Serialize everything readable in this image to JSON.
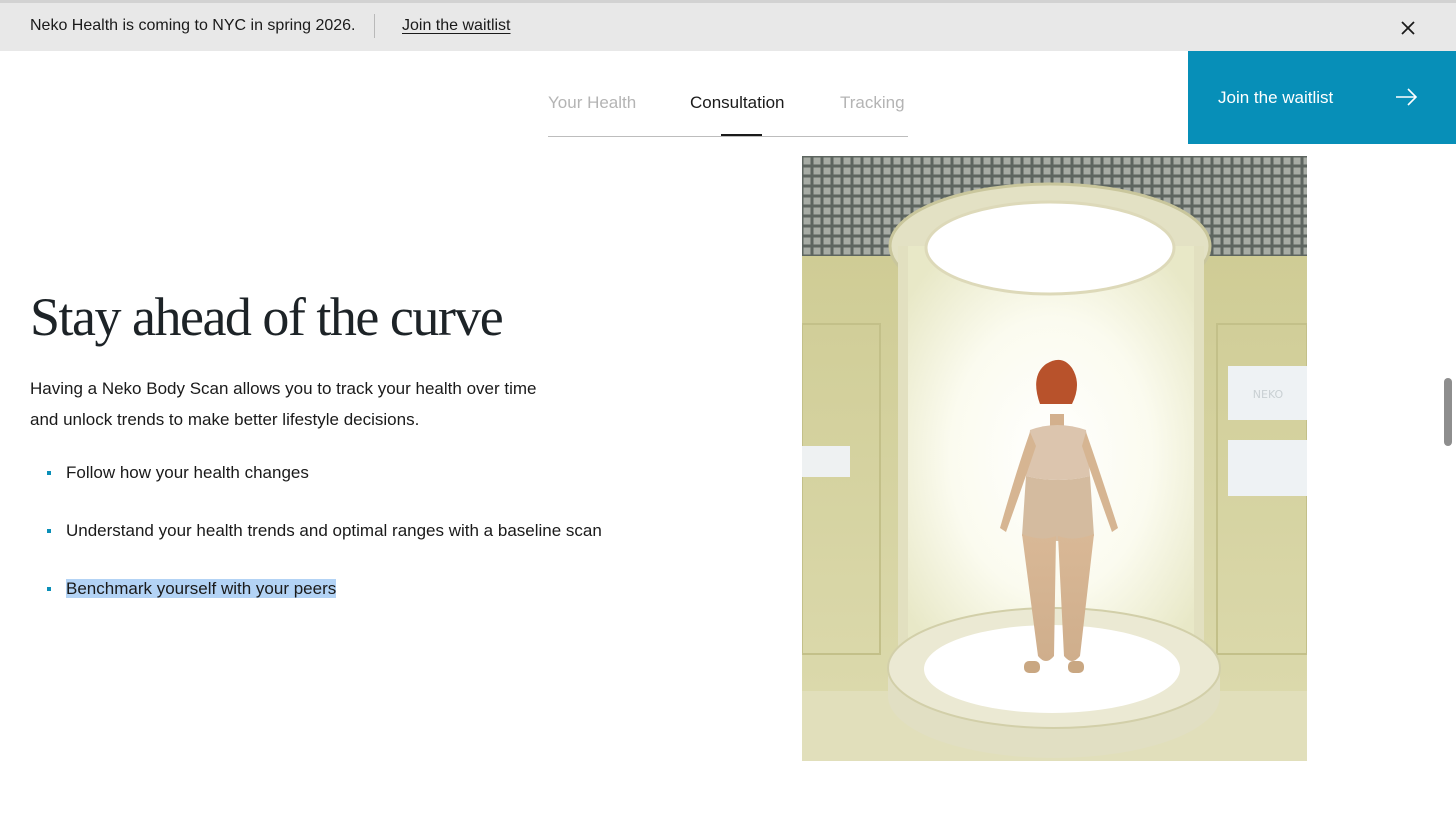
{
  "announcement": {
    "text": "Neko Health is coming to NYC in spring 2026.",
    "link_label": "Join the waitlist",
    "close_icon": "close-icon"
  },
  "tabs": [
    {
      "label": "Your Health",
      "active": false
    },
    {
      "label": "Consultation",
      "active": true
    },
    {
      "label": "Tracking",
      "active": false
    }
  ],
  "cta": {
    "label": "Join the waitlist",
    "icon": "arrow-right-icon",
    "color": "#078fb8"
  },
  "content": {
    "headline": "Stay ahead of the curve",
    "intro": "Having a Neko Body Scan allows you to track your health over time and unlock trends to make better lifestyle decisions.",
    "bullets": [
      "Follow how your health changes",
      "Understand your health trends and optimal ranges with a baseline scan",
      "Benchmark yourself with your peers"
    ]
  },
  "image": {
    "screen_text": "NEKO"
  },
  "colors": {
    "accent": "#078fb8",
    "selection_highlight": "#b3d3f5"
  }
}
